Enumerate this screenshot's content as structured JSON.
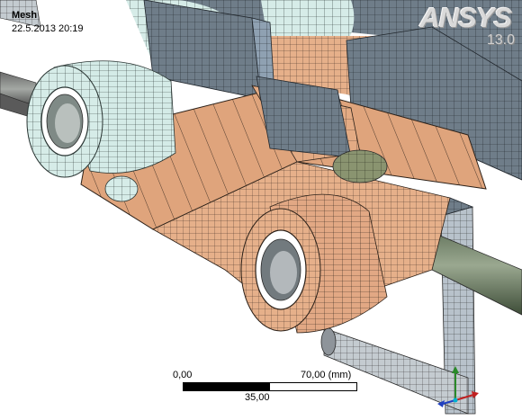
{
  "header": {
    "title": "Mesh",
    "date": "22.5.2013 20:19"
  },
  "logo": {
    "brand": "ANSYS",
    "version": "13.0"
  },
  "scale_bar": {
    "start_label": "0,00",
    "end_label": "70,00 (mm)",
    "mid_label": "35,00"
  },
  "colors": {
    "background": "#ffffff",
    "tan_mesh": "#e3ab84",
    "mint_mesh": "#d6ece8",
    "slate_mesh": "#6f7d89",
    "shaft": "#8f9a8c",
    "shaft_dark": "#4b5e42",
    "mesh_line": "#2a2a2a"
  }
}
